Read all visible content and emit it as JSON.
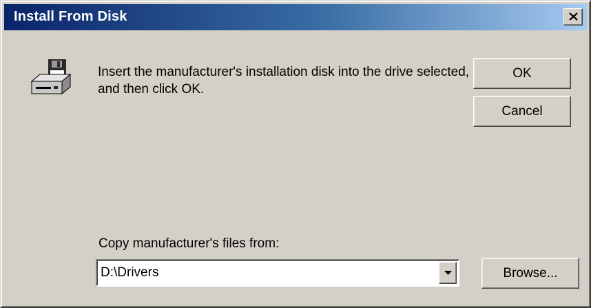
{
  "window": {
    "title": "Install From Disk"
  },
  "icons": {
    "close": "close-icon",
    "disk": "floppy-drive-icon",
    "dropdown": "chevron-down-icon"
  },
  "message": "Insert the manufacturer's installation disk into the drive selected, and then click OK.",
  "buttons": {
    "ok": "OK",
    "cancel": "Cancel",
    "browse": "Browse..."
  },
  "copy_from": {
    "label": "Copy manufacturer's files from:",
    "value": "D:\\Drivers"
  },
  "colors": {
    "title_start": "#0a246a",
    "title_end": "#a6caf0",
    "face": "#d4d0c8"
  }
}
